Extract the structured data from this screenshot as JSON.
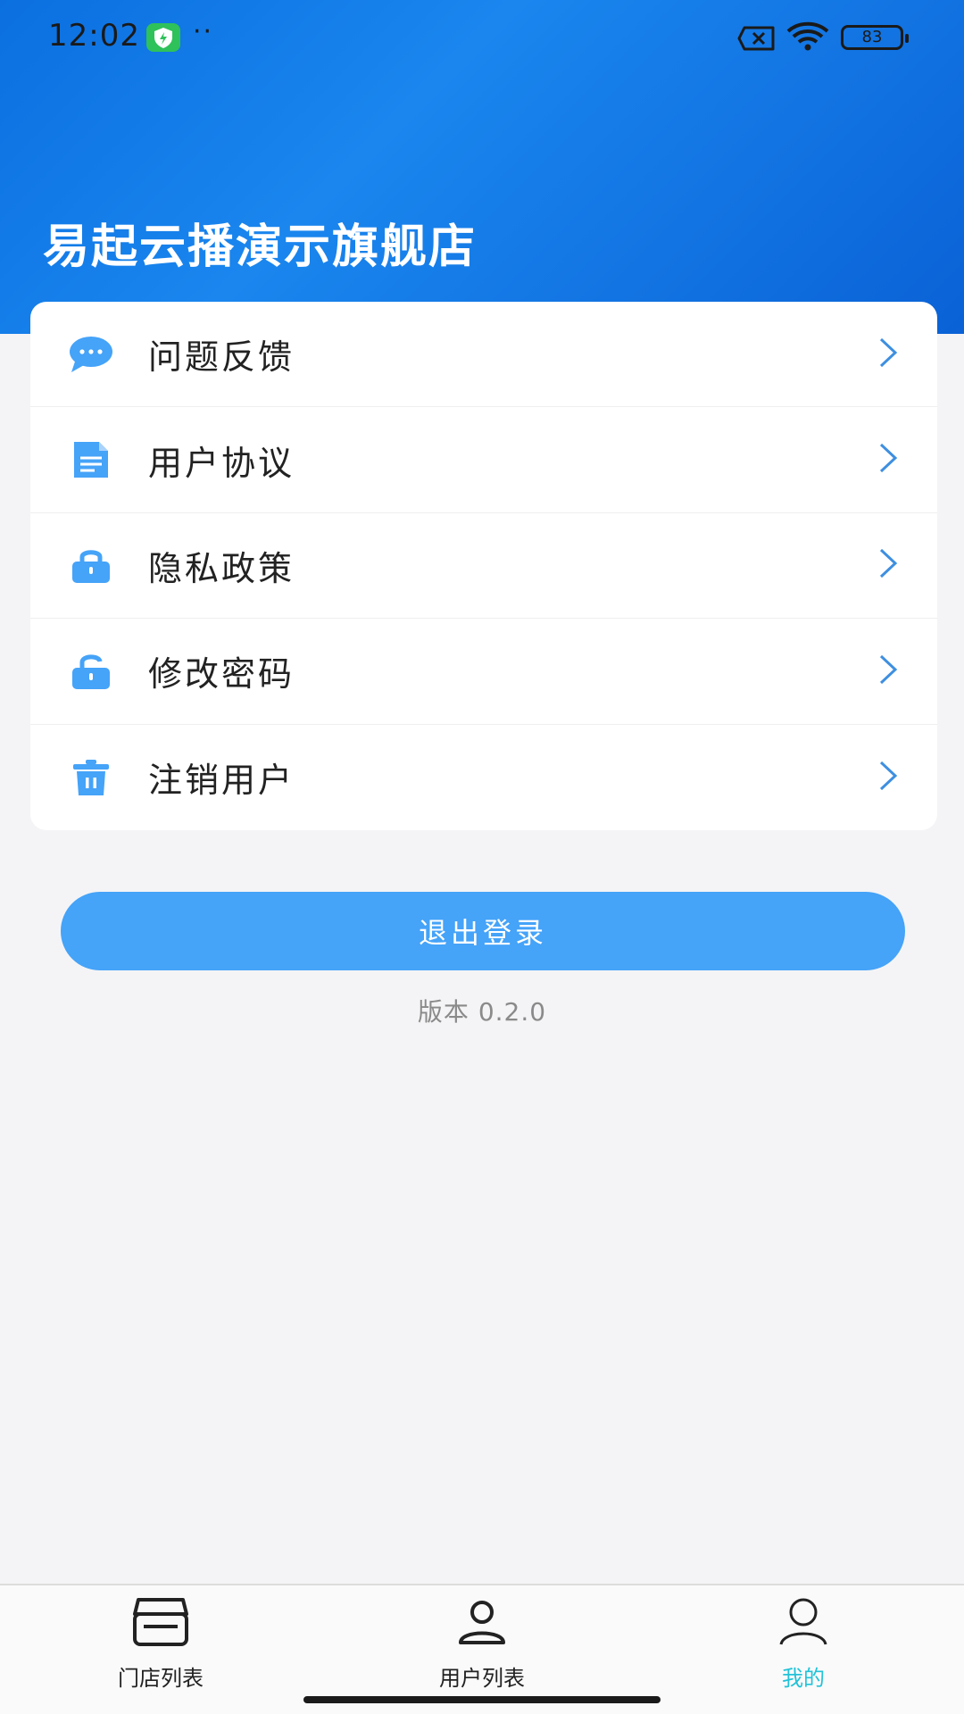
{
  "status_bar": {
    "time": "12:02",
    "dots": "··",
    "battery": "83",
    "icons": [
      "shield-icon",
      "sim-off-icon",
      "wifi-icon",
      "battery-icon"
    ]
  },
  "header": {
    "title": "易起云播演示旗舰店"
  },
  "menu": {
    "items": [
      {
        "label": "问题反馈",
        "icon": "chat-bubble-icon"
      },
      {
        "label": "用户协议",
        "icon": "document-icon"
      },
      {
        "label": "隐私政策",
        "icon": "lock-icon"
      },
      {
        "label": "修改密码",
        "icon": "unlock-icon"
      },
      {
        "label": "注销用户",
        "icon": "trash-icon"
      }
    ],
    "icon_color": "#45a3f8",
    "chevron_color": "#3e8fe0"
  },
  "logout": {
    "label": "退出登录",
    "color": "#45a3f8"
  },
  "version": "版本 0.2.0",
  "tab_bar": {
    "tabs": [
      {
        "label": "门店列表",
        "icon": "store-icon",
        "active": false
      },
      {
        "label": "用户列表",
        "icon": "user-icon",
        "active": false
      },
      {
        "label": "我的",
        "icon": "profile-icon",
        "active": true
      }
    ],
    "active_color": "#22c2d8"
  }
}
